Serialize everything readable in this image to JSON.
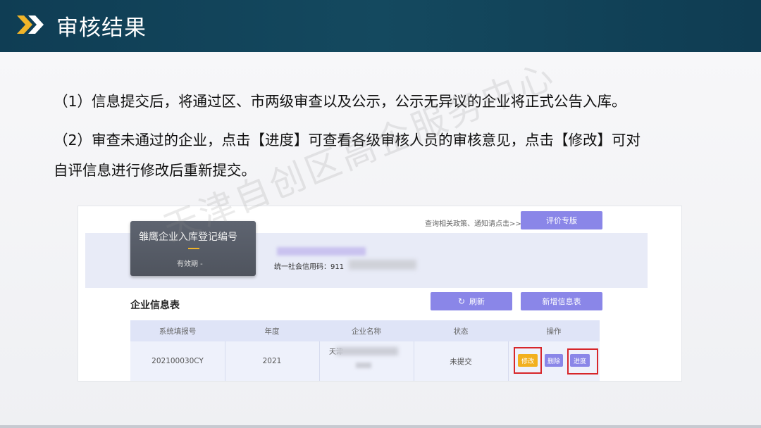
{
  "slide": {
    "title": "审核结果",
    "accent_color": "#f0b429",
    "header_color": "#124459",
    "paragraphs": [
      "（1）信息提交后，将通过区、市两级审查以及公示，公示无异议的企业将正式公告入库。",
      "（2）审查未通过的企业，点击【进度】可查看各级审核人员的审核意见，点击【修改】可对",
      "自评信息进行修改后重新提交。"
    ],
    "watermark": "天津自创区高企服务中心"
  },
  "screenshot": {
    "notice": "查询相关政策、通知请点击>>",
    "eval_button": "评价专版",
    "badge": {
      "title": "雏鹰企业入库登记编号",
      "dash": "—",
      "valid": "有效期 -"
    },
    "credit_code": "统一社会信用码：911",
    "section_title": "企业信息表",
    "refresh_button": "刷新",
    "add_button": "新增信息表",
    "table": {
      "headers": [
        "系统填报号",
        "年度",
        "企业名称",
        "状态",
        "操作"
      ],
      "row": {
        "id": "202100030CY",
        "year": "2021",
        "name": "天津",
        "status": "未提交",
        "actions": [
          "修改",
          "删除",
          "进度"
        ]
      }
    },
    "button_color": "#8a86e8",
    "edit_color": "#f2b01e",
    "highlight_color": "#d7262a"
  }
}
